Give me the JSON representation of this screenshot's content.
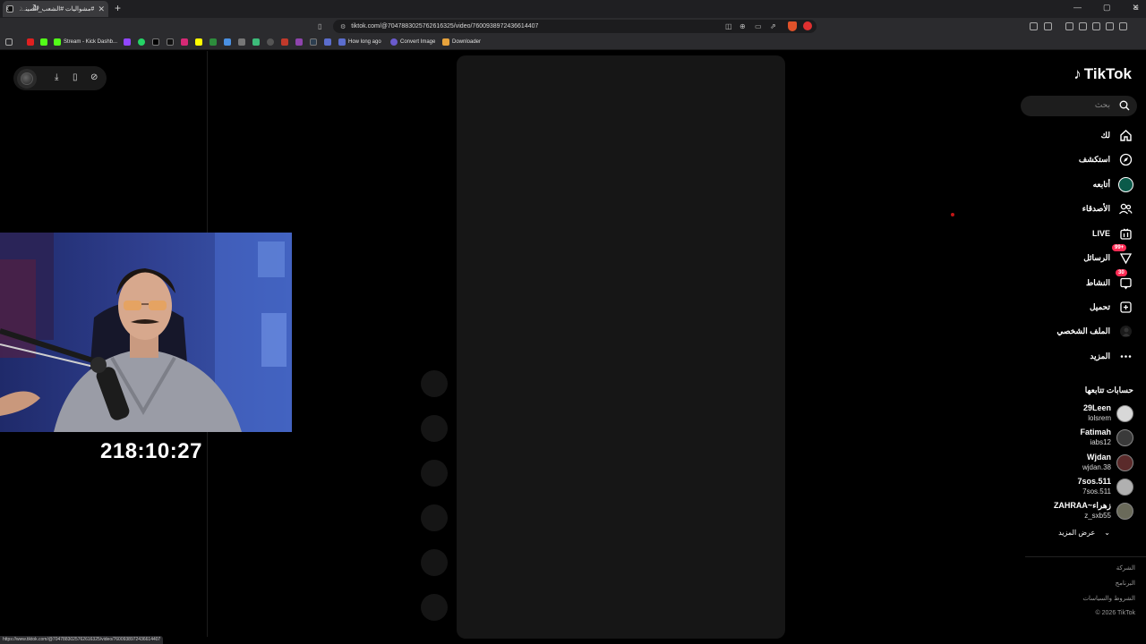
{
  "browser": {
    "tab_title": "#مشواليات #الشعب_الصيني_ماله",
    "url": "tiktok.com/@7047883025762616325/video/7600938972436614407",
    "status_url": "https://www.tiktok.com/@7047883025762616325/video/7600938972436614407",
    "bookmarks": [
      "Stream - Kick Dashb...",
      "How long ago",
      "Convert Image",
      "Downloader"
    ]
  },
  "tiktok": {
    "logo_text": "TikTok",
    "search_placeholder": "بحث",
    "nav": [
      {
        "label": "لك",
        "icon": "home-icon"
      },
      {
        "label": "استكشف",
        "icon": "compass-icon"
      },
      {
        "label": "أتابعه",
        "icon": "following-avatar-icon"
      },
      {
        "label": "الأصدقاء",
        "icon": "friends-icon"
      },
      {
        "label": "LIVE",
        "icon": "live-icon"
      },
      {
        "label": "الرسائل",
        "icon": "messages-icon",
        "badge": "99+"
      },
      {
        "label": "النشاط",
        "icon": "activity-icon",
        "badge": "30"
      },
      {
        "label": "تحميل",
        "icon": "upload-icon"
      },
      {
        "label": "الملف الشخصي",
        "icon": "profile-icon"
      },
      {
        "label": "المزيد",
        "icon": "more-icon"
      }
    ],
    "following_header": "حسابات تتابعها",
    "accounts": [
      {
        "name": "29Leen",
        "handle": "lolsrem"
      },
      {
        "name": "Fatimah",
        "handle": "iabs12"
      },
      {
        "name": "Wjdan",
        "handle": "wjdan.38"
      },
      {
        "name": "7sos.511",
        "handle": "7sos.511"
      },
      {
        "name": "ZAHRAA~زهراء",
        "handle": "z_sxb55"
      }
    ],
    "see_more": "عرض المزيد",
    "footer": [
      "الشركة",
      "البرنامج",
      "الشروط والسياسات",
      "© 2026 TikTok"
    ]
  },
  "overlay": {
    "timer": "218:10:27"
  },
  "colors": {
    "accent": "#fe2c55",
    "page_bg": "#000000",
    "video_bg": "#161616"
  }
}
